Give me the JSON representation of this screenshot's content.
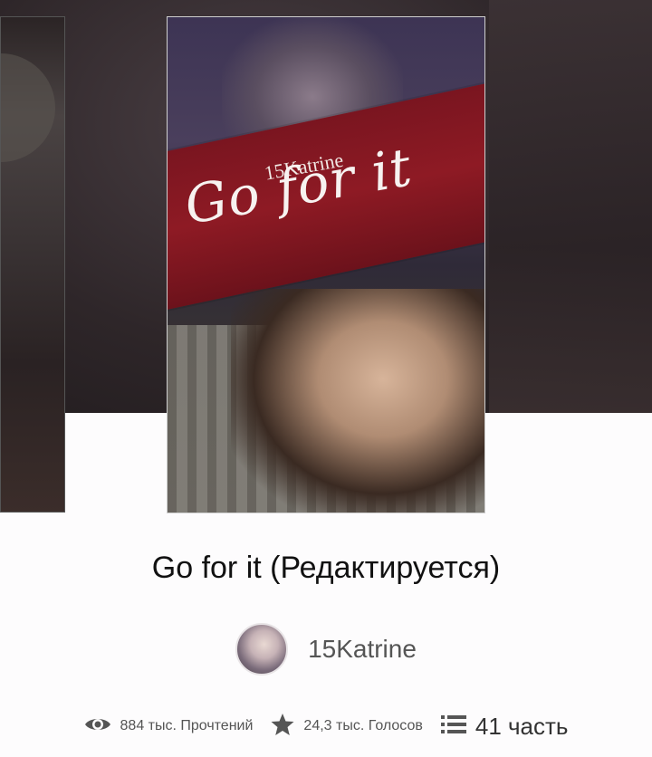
{
  "cover": {
    "author_text": "15Katrine",
    "title_text": "Go for it"
  },
  "story": {
    "title": "Go for it (Редактируется)",
    "author": "15Katrine"
  },
  "stats": {
    "reads": "884 тыс. Прочтений",
    "votes": "24,3 тыс. Голосов",
    "parts": "41 часть"
  },
  "icons": {
    "reads": "eye-icon",
    "votes": "star-icon",
    "parts": "list-icon"
  },
  "colors": {
    "cover_red": "#8e1a24",
    "text_dark": "#111111",
    "text_gray": "#555555"
  }
}
